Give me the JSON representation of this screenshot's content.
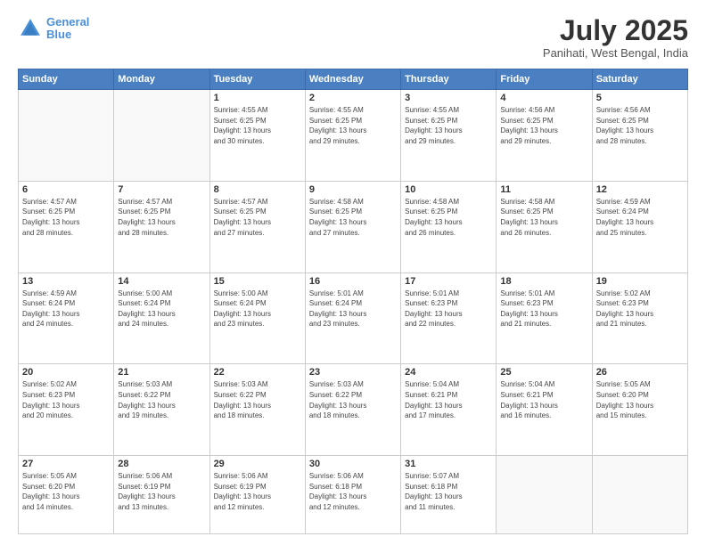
{
  "header": {
    "logo_line1": "General",
    "logo_line2": "Blue",
    "month_year": "July 2025",
    "location": "Panihati, West Bengal, India"
  },
  "weekdays": [
    "Sunday",
    "Monday",
    "Tuesday",
    "Wednesday",
    "Thursday",
    "Friday",
    "Saturday"
  ],
  "weeks": [
    [
      {
        "day": "",
        "info": ""
      },
      {
        "day": "",
        "info": ""
      },
      {
        "day": "1",
        "info": "Sunrise: 4:55 AM\nSunset: 6:25 PM\nDaylight: 13 hours\nand 30 minutes."
      },
      {
        "day": "2",
        "info": "Sunrise: 4:55 AM\nSunset: 6:25 PM\nDaylight: 13 hours\nand 29 minutes."
      },
      {
        "day": "3",
        "info": "Sunrise: 4:55 AM\nSunset: 6:25 PM\nDaylight: 13 hours\nand 29 minutes."
      },
      {
        "day": "4",
        "info": "Sunrise: 4:56 AM\nSunset: 6:25 PM\nDaylight: 13 hours\nand 29 minutes."
      },
      {
        "day": "5",
        "info": "Sunrise: 4:56 AM\nSunset: 6:25 PM\nDaylight: 13 hours\nand 28 minutes."
      }
    ],
    [
      {
        "day": "6",
        "info": "Sunrise: 4:57 AM\nSunset: 6:25 PM\nDaylight: 13 hours\nand 28 minutes."
      },
      {
        "day": "7",
        "info": "Sunrise: 4:57 AM\nSunset: 6:25 PM\nDaylight: 13 hours\nand 28 minutes."
      },
      {
        "day": "8",
        "info": "Sunrise: 4:57 AM\nSunset: 6:25 PM\nDaylight: 13 hours\nand 27 minutes."
      },
      {
        "day": "9",
        "info": "Sunrise: 4:58 AM\nSunset: 6:25 PM\nDaylight: 13 hours\nand 27 minutes."
      },
      {
        "day": "10",
        "info": "Sunrise: 4:58 AM\nSunset: 6:25 PM\nDaylight: 13 hours\nand 26 minutes."
      },
      {
        "day": "11",
        "info": "Sunrise: 4:58 AM\nSunset: 6:25 PM\nDaylight: 13 hours\nand 26 minutes."
      },
      {
        "day": "12",
        "info": "Sunrise: 4:59 AM\nSunset: 6:24 PM\nDaylight: 13 hours\nand 25 minutes."
      }
    ],
    [
      {
        "day": "13",
        "info": "Sunrise: 4:59 AM\nSunset: 6:24 PM\nDaylight: 13 hours\nand 24 minutes."
      },
      {
        "day": "14",
        "info": "Sunrise: 5:00 AM\nSunset: 6:24 PM\nDaylight: 13 hours\nand 24 minutes."
      },
      {
        "day": "15",
        "info": "Sunrise: 5:00 AM\nSunset: 6:24 PM\nDaylight: 13 hours\nand 23 minutes."
      },
      {
        "day": "16",
        "info": "Sunrise: 5:01 AM\nSunset: 6:24 PM\nDaylight: 13 hours\nand 23 minutes."
      },
      {
        "day": "17",
        "info": "Sunrise: 5:01 AM\nSunset: 6:23 PM\nDaylight: 13 hours\nand 22 minutes."
      },
      {
        "day": "18",
        "info": "Sunrise: 5:01 AM\nSunset: 6:23 PM\nDaylight: 13 hours\nand 21 minutes."
      },
      {
        "day": "19",
        "info": "Sunrise: 5:02 AM\nSunset: 6:23 PM\nDaylight: 13 hours\nand 21 minutes."
      }
    ],
    [
      {
        "day": "20",
        "info": "Sunrise: 5:02 AM\nSunset: 6:23 PM\nDaylight: 13 hours\nand 20 minutes."
      },
      {
        "day": "21",
        "info": "Sunrise: 5:03 AM\nSunset: 6:22 PM\nDaylight: 13 hours\nand 19 minutes."
      },
      {
        "day": "22",
        "info": "Sunrise: 5:03 AM\nSunset: 6:22 PM\nDaylight: 13 hours\nand 18 minutes."
      },
      {
        "day": "23",
        "info": "Sunrise: 5:03 AM\nSunset: 6:22 PM\nDaylight: 13 hours\nand 18 minutes."
      },
      {
        "day": "24",
        "info": "Sunrise: 5:04 AM\nSunset: 6:21 PM\nDaylight: 13 hours\nand 17 minutes."
      },
      {
        "day": "25",
        "info": "Sunrise: 5:04 AM\nSunset: 6:21 PM\nDaylight: 13 hours\nand 16 minutes."
      },
      {
        "day": "26",
        "info": "Sunrise: 5:05 AM\nSunset: 6:20 PM\nDaylight: 13 hours\nand 15 minutes."
      }
    ],
    [
      {
        "day": "27",
        "info": "Sunrise: 5:05 AM\nSunset: 6:20 PM\nDaylight: 13 hours\nand 14 minutes."
      },
      {
        "day": "28",
        "info": "Sunrise: 5:06 AM\nSunset: 6:19 PM\nDaylight: 13 hours\nand 13 minutes."
      },
      {
        "day": "29",
        "info": "Sunrise: 5:06 AM\nSunset: 6:19 PM\nDaylight: 13 hours\nand 12 minutes."
      },
      {
        "day": "30",
        "info": "Sunrise: 5:06 AM\nSunset: 6:18 PM\nDaylight: 13 hours\nand 12 minutes."
      },
      {
        "day": "31",
        "info": "Sunrise: 5:07 AM\nSunset: 6:18 PM\nDaylight: 13 hours\nand 11 minutes."
      },
      {
        "day": "",
        "info": ""
      },
      {
        "day": "",
        "info": ""
      }
    ]
  ]
}
